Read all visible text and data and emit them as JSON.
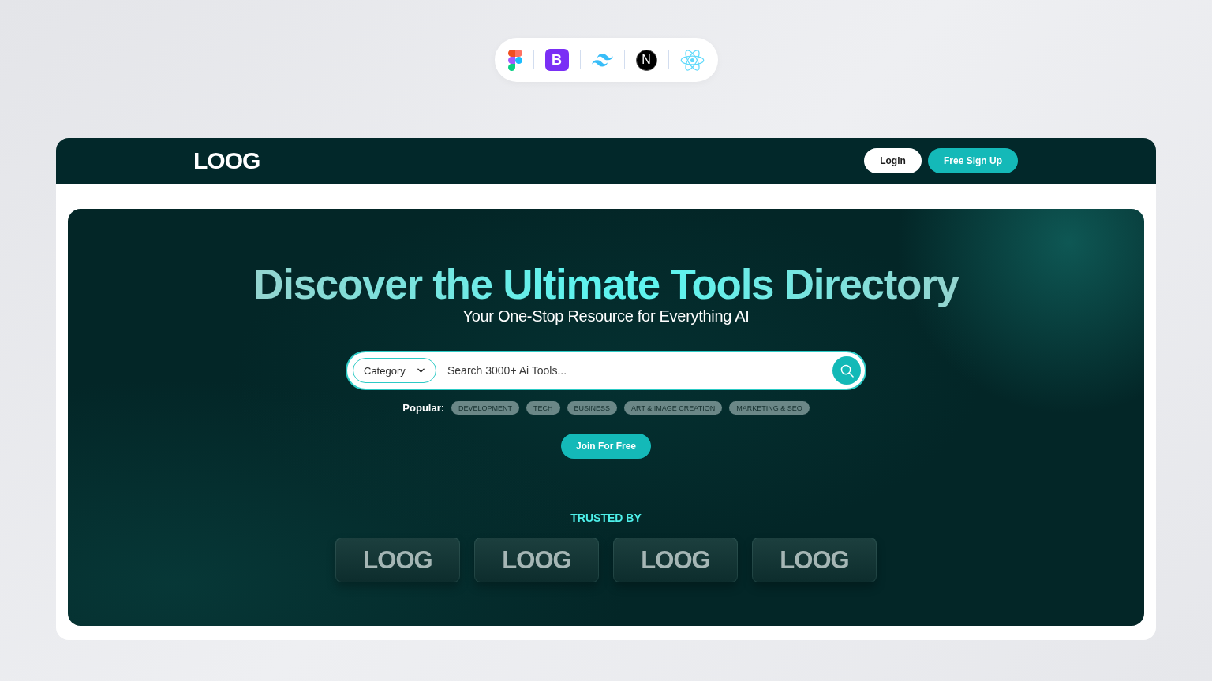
{
  "tech_stack": [
    {
      "kind": "shapes"
    },
    {
      "kind": "letter-tile",
      "letter": "B"
    },
    {
      "kind": "waves"
    },
    {
      "kind": "letter-circle",
      "letter": "N"
    },
    {
      "kind": "atom"
    }
  ],
  "header": {
    "logo": "LOOG",
    "buttons": [
      {
        "label": "Login",
        "kind": "secondary"
      },
      {
        "label": "Free Sign Up",
        "kind": "primary"
      }
    ]
  },
  "hero": {
    "title": "Discover the Ultimate Tools Directory",
    "subtitle": "Your One-Stop Resource for Everything AI",
    "search": {
      "category": "Category",
      "placeholder": "Search 3000+ Ai Tools..."
    },
    "popular": {
      "label": "Popular:",
      "tags": [
        "DEVELOPMENT",
        "TECH",
        "BUSINESS",
        "ART & IMAGE CREATION",
        "MARKETING & SEO"
      ]
    },
    "cta": "Join For Free",
    "trusted": {
      "heading": "TRUSTED BY",
      "logos": [
        "LOOG",
        "LOOG",
        "LOOG",
        "LOOG"
      ]
    }
  }
}
